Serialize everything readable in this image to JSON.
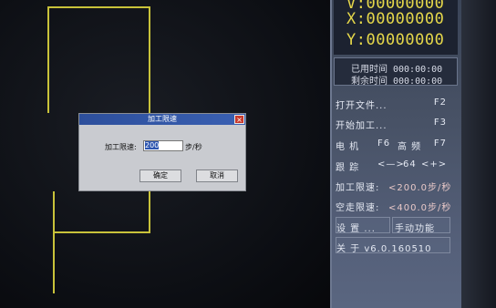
{
  "coords": {
    "v": "V:00000000",
    "x": "X:00000000",
    "y": "Y:00000000"
  },
  "time": {
    "used_label": "已用时间",
    "used_value": "000:00:00",
    "remain_label": "剩余时间",
    "remain_value": "000:00:00"
  },
  "menu": {
    "open_file": "打开文件...",
    "open_file_key": "F2",
    "start_process": "开始加工...",
    "start_process_key": "F3",
    "motor_label": "电  机",
    "motor_key": "F6",
    "motor_value": "高  频",
    "motor_value_key": "F7",
    "track_label": "跟  踪",
    "track_left": "<—>",
    "track_value": "64",
    "track_right": "<+>",
    "process_limit_label": "加工限速:",
    "process_limit_value": "<200.0步/秒",
    "idle_limit_label": "空走限速:",
    "idle_limit_value": "<400.0步/秒",
    "settings": "设  置 ...",
    "manual": "手动功能",
    "about": "关  于  v6.0.160510"
  },
  "dialog": {
    "title": "加工限速",
    "close": "×",
    "field_label": "加工限速:",
    "field_value": "200",
    "unit": "步/秒",
    "ok": "确定",
    "cancel": "取消"
  },
  "colors": {
    "accent_yellow": "#e6d84a",
    "title_bar": "#2d4f9c",
    "panel": "#485266"
  }
}
